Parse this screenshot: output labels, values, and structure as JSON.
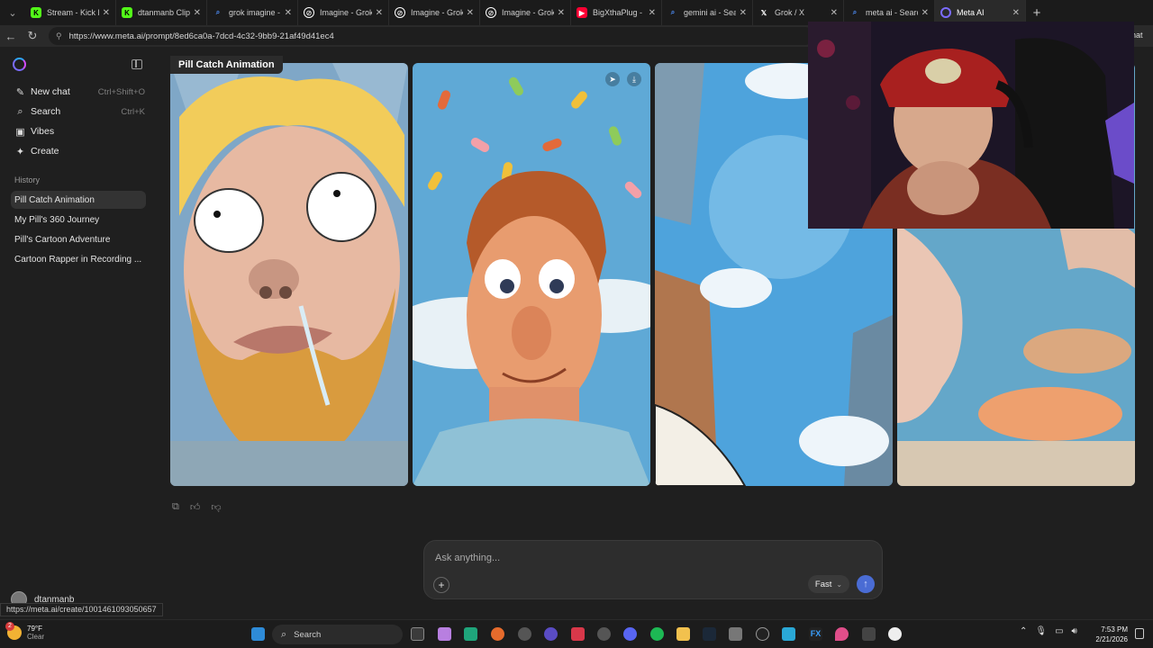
{
  "browser": {
    "tabs": [
      {
        "title": "Stream - Kick Das",
        "icon": "kick-icon",
        "color": "#53fc18"
      },
      {
        "title": "dtanmanb Clips -",
        "icon": "kick-icon",
        "color": "#53fc18"
      },
      {
        "title": "grok imagine - Se",
        "icon": "search-icon",
        "color": "#4c8bf5"
      },
      {
        "title": "Imagine - Grok",
        "icon": "grok-icon",
        "color": "#ffffff"
      },
      {
        "title": "Imagine - Grok",
        "icon": "grok-icon",
        "color": "#ffffff"
      },
      {
        "title": "Imagine - Grok",
        "icon": "grok-icon",
        "color": "#ffffff"
      },
      {
        "title": "BigXthaPlug - Bo",
        "icon": "youtube-icon",
        "color": "#ff0033"
      },
      {
        "title": "gemini ai - Search",
        "icon": "search-icon",
        "color": "#4c8bf5"
      },
      {
        "title": "Grok / X",
        "icon": "x-icon",
        "color": "#ffffff"
      },
      {
        "title": "meta ai - Search",
        "icon": "search-icon",
        "color": "#4c8bf5"
      },
      {
        "title": "Meta AI",
        "icon": "meta-ai-icon",
        "color": "#7b6cff"
      }
    ],
    "url": "https://www.meta.ai/prompt/8ed6ca0a-7dcd-4c32-9bb9-21af49d41ec4",
    "status_url": "https://meta.ai/create/1001461093050657",
    "partial_right_text": "hat"
  },
  "sidebar": {
    "nav": [
      {
        "label": "New chat",
        "shortcut": "Ctrl+Shift+O",
        "icon": "new-chat-icon"
      },
      {
        "label": "Search",
        "shortcut": "Ctrl+K",
        "icon": "search-icon"
      },
      {
        "label": "Vibes",
        "shortcut": "",
        "icon": "vibes-icon"
      },
      {
        "label": "Create",
        "shortcut": "",
        "icon": "create-icon"
      }
    ],
    "history_label": "History",
    "history": [
      {
        "label": "Pill Catch Animation",
        "selected": true
      },
      {
        "label": "My Pill's 360 Journey",
        "selected": false
      },
      {
        "label": "Pill's Cartoon Adventure",
        "selected": false
      },
      {
        "label": "Cartoon Rapper in Recording ...",
        "selected": false
      }
    ],
    "user": "dtanmanb"
  },
  "main": {
    "title": "Pill Catch Animation",
    "prompt_placeholder": "Ask anything...",
    "mode": "Fast"
  },
  "taskbar": {
    "weather_temp": "79°F",
    "weather_desc": "Clear",
    "weather_badge": "2",
    "search_label": "Search",
    "time": "7:53 PM",
    "date": "2/21/2026"
  },
  "colors": {
    "accent": "#4a6cd4",
    "background": "#1f1f1f"
  }
}
